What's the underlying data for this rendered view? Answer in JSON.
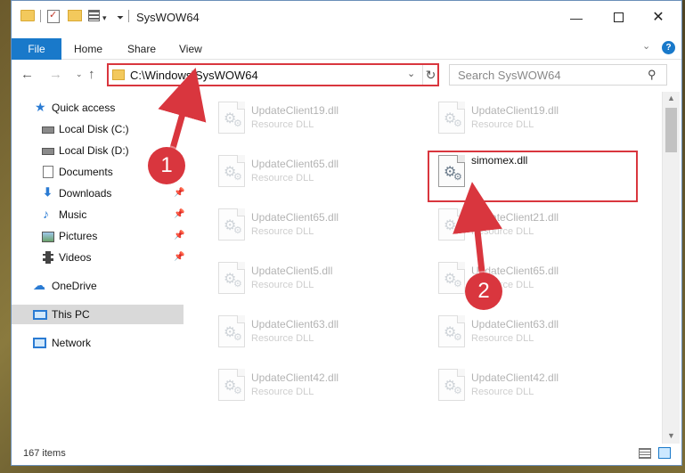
{
  "window": {
    "title": "SysWOW64",
    "minimize": "—",
    "close": "✕"
  },
  "ribbon": {
    "tabs": [
      {
        "label": "File"
      },
      {
        "label": "Home"
      },
      {
        "label": "Share"
      },
      {
        "label": "View"
      }
    ],
    "help": "?"
  },
  "address": {
    "path": "C:\\Windows\\SysWOW64",
    "search_placeholder": "Search SysWOW64"
  },
  "nav": {
    "quick_access": "Quick access",
    "items": [
      {
        "label": "Local Disk (C:)",
        "pinned": false,
        "icon": "disk-icon"
      },
      {
        "label": "Local Disk (D:)",
        "pinned": false,
        "icon": "disk-icon"
      },
      {
        "label": "Documents",
        "pinned": false,
        "icon": "documents-icon"
      },
      {
        "label": "Downloads",
        "pinned": true,
        "icon": "downloads-icon"
      },
      {
        "label": "Music",
        "pinned": true,
        "icon": "music-icon"
      },
      {
        "label": "Pictures",
        "pinned": true,
        "icon": "pictures-icon"
      },
      {
        "label": "Videos",
        "pinned": true,
        "icon": "videos-icon"
      }
    ],
    "onedrive": "OneDrive",
    "this_pc": "This PC",
    "network": "Network"
  },
  "files": {
    "col1": [
      {
        "name": "UpdateClient19.dll",
        "type": "Resource DLL"
      },
      {
        "name": "UpdateClient65.dll",
        "type": "Resource DLL"
      },
      {
        "name": "UpdateClient65.dll",
        "type": "Resource DLL"
      },
      {
        "name": "UpdateClient5.dll",
        "type": "Resource DLL"
      },
      {
        "name": "UpdateClient63.dll",
        "type": "Resource DLL"
      },
      {
        "name": "UpdateClient42.dll",
        "type": "Resource DLL"
      }
    ],
    "col2": [
      {
        "name": "UpdateClient19.dll",
        "type": "Resource DLL"
      },
      {
        "name": "simomex.dll",
        "type": ""
      },
      {
        "name": "UpdateClient21.dll",
        "type": "Resource DLL"
      },
      {
        "name": "UpdateClient65.dll",
        "type": "Resource DLL"
      },
      {
        "name": "UpdateClient63.dll",
        "type": "Resource DLL"
      },
      {
        "name": "UpdateClient42.dll",
        "type": "Resource DLL"
      }
    ]
  },
  "status": {
    "item_count": "167 items"
  },
  "annotations": {
    "step1": "1",
    "step2": "2",
    "color": "#d9363e"
  }
}
